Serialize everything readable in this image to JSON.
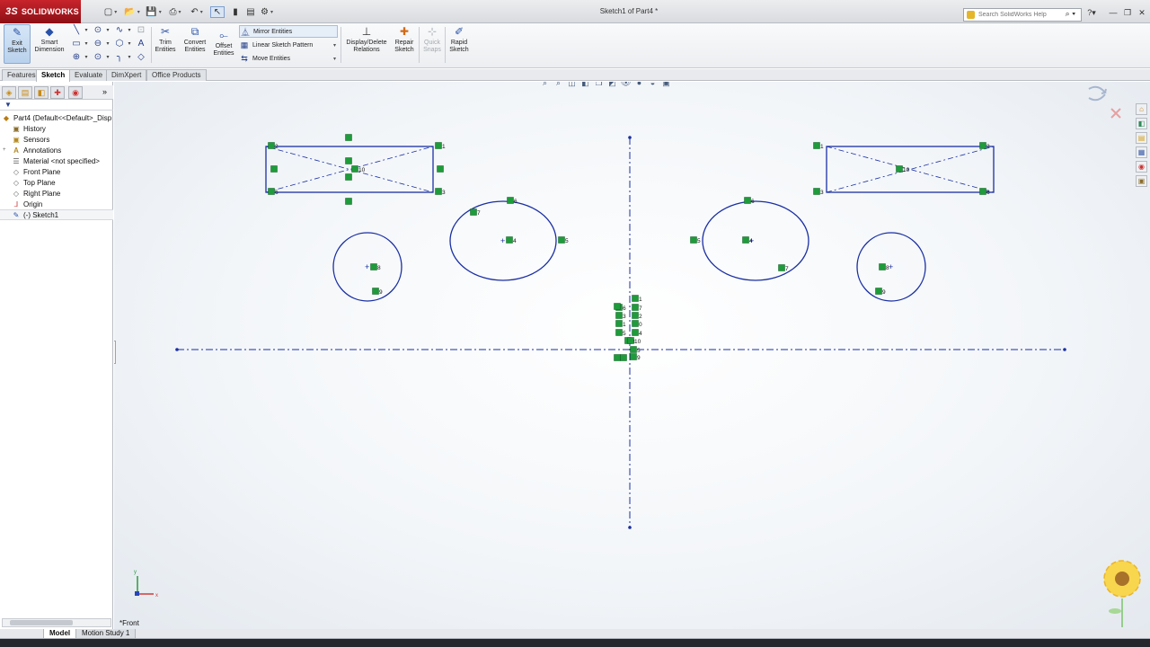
{
  "app": {
    "brand": "SOLIDWORKS",
    "document_title": "Sketch1 of Part4 *"
  },
  "search": {
    "placeholder": "Search SolidWorks Help"
  },
  "ribbon": {
    "exit_sketch": "Exit Sketch",
    "smart_dimension": "Smart Dimension",
    "trim_entities": "Trim Entities",
    "convert_entities": "Convert Entities",
    "offset_entities": "Offset Entities",
    "mirror_entities": "Mirror Entities",
    "linear_sketch_pattern": "Linear Sketch Pattern",
    "move_entities": "Move Entities",
    "display_delete_relations": "Display/Delete Relations",
    "repair_sketch": "Repair Sketch",
    "quick_snaps": "Quick Snaps",
    "rapid_sketch": "Rapid Sketch"
  },
  "tabs": [
    "Features",
    "Sketch",
    "Evaluate",
    "DimXpert",
    "Office Products"
  ],
  "active_tab": "Sketch",
  "feature_tree": {
    "root": "Part4  (Default<<Default>_Disp",
    "items": [
      "History",
      "Sensors",
      "Annotations",
      "Material <not specified>",
      "Front Plane",
      "Top Plane",
      "Right Plane",
      "Origin",
      "(-) Sketch1"
    ]
  },
  "view": {
    "orientation_label": "*Front"
  },
  "bottom_tabs": [
    "Model",
    "Motion Study 1"
  ],
  "colors": {
    "sketch_blue": "#1a2fa3",
    "relation_green": "#1e9b3a",
    "brand_red": "#c8242b"
  },
  "relations": {
    "left_rect": [
      "2",
      "1",
      "6",
      "3",
      "10"
    ],
    "right_rect": [
      "1",
      "2",
      "3",
      "6",
      "10"
    ],
    "left_circle": [
      "8",
      "9"
    ],
    "left_ellipse": [
      "6",
      "7",
      "4",
      "5"
    ],
    "right_ellipse": [
      "6",
      "5",
      "4",
      "7"
    ],
    "right_circle": [
      "8",
      "9"
    ],
    "center_stack_left": [
      "6",
      "3",
      "1",
      "5",
      "8"
    ],
    "center_stack_right": [
      "1",
      "7",
      "2",
      "0",
      "4",
      "10",
      "5",
      "9"
    ]
  }
}
